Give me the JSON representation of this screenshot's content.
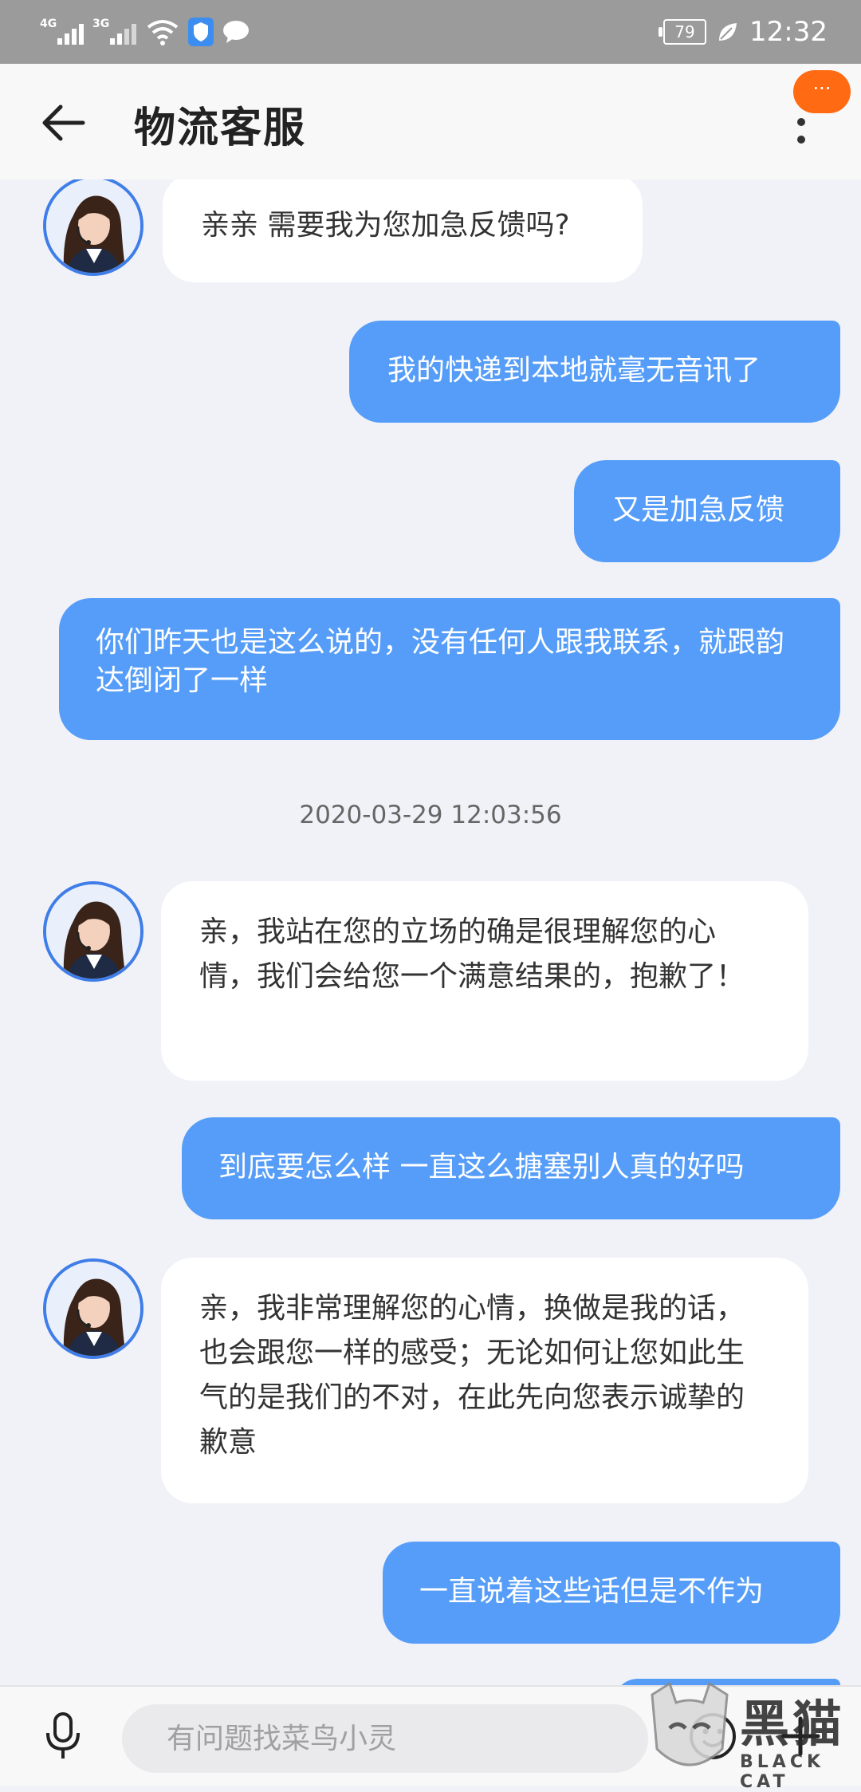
{
  "status_bar": {
    "network_1": "4G",
    "network_2": "3G",
    "battery": "79",
    "time": "12:32"
  },
  "header": {
    "title": "物流客服",
    "more_badge": "···"
  },
  "messages": [
    {
      "sender": "agent",
      "text": "亲亲 需要我为您加急反馈吗?"
    },
    {
      "sender": "user",
      "text": "我的快递到本地就毫无音讯了"
    },
    {
      "sender": "user",
      "text": "又是加急反馈"
    },
    {
      "sender": "user",
      "text": "你们昨天也是这么说的，没有任何人跟我联系，就跟韵达倒闭了一样"
    },
    {
      "sender": "agent",
      "text": "亲，我站在您的立场的确是很理解您的心情，我们会给您一个满意结果的，抱歉了！"
    },
    {
      "sender": "user",
      "text": "到底要怎么样 一直这么搪塞别人真的好吗"
    },
    {
      "sender": "agent",
      "text": "亲，我非常理解您的心情，换做是我的话，也会跟您一样的感受；无论如何让您如此生气的是我们的不对，在此先向您表示诚挚的歉意"
    },
    {
      "sender": "user",
      "text": "一直说着这些话但是不作为"
    }
  ],
  "timestamp": "2020-03-29 12:03:56",
  "input": {
    "placeholder": "有问题找菜鸟小灵"
  },
  "watermark": {
    "text": "黑猫",
    "subtext": "BLACK CAT"
  },
  "colors": {
    "user_bubble": "#559df8",
    "agent_bubble": "#ffffff",
    "background": "#f1f2f7",
    "accent": "#ff6a13"
  }
}
